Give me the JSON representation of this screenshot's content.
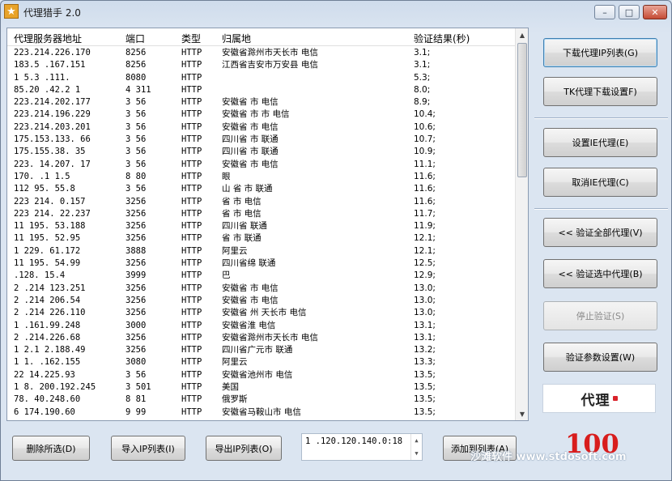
{
  "window": {
    "title": "代理猎手 2.0",
    "controls": {
      "minimize": "–",
      "maximize": "□",
      "close": "✕"
    }
  },
  "list": {
    "headers": {
      "address": "代理服务器地址",
      "port": "端口",
      "type": "类型",
      "location": "归属地",
      "result": "验证结果(秒)"
    },
    "rows": [
      {
        "address": "223.214.226.170",
        "port": "8256",
        "type": "HTTP",
        "location": "安徽省滁州市天长市 电信",
        "result": "3.1;"
      },
      {
        "address": "183.5 .167.151",
        "port": "8256",
        "type": "HTTP",
        "location": "江西省吉安市万安县 电信",
        "result": "3.1;"
      },
      {
        "address": "1 5.3 .111.",
        "port": "8080",
        "type": "HTTP",
        "location": "",
        "result": "5.3;"
      },
      {
        "address": "85.20 .42.2 1",
        "port": "4 311",
        "type": "HTTP",
        "location": "",
        "result": "8.0;"
      },
      {
        "address": "223.214.202.177",
        "port": "3 56",
        "type": "HTTP",
        "location": "安徽省 市 电信",
        "result": "8.9;"
      },
      {
        "address": "223.214.196.229",
        "port": "3 56",
        "type": "HTTP",
        "location": "安徽省 市 市 电信",
        "result": "10.4;"
      },
      {
        "address": "223.214.203.201",
        "port": "3 56",
        "type": "HTTP",
        "location": "安徽省 市 电信",
        "result": "10.6;"
      },
      {
        "address": "175.153.133. 66",
        "port": "3 56",
        "type": "HTTP",
        "location": "四川省 市 联通",
        "result": "10.7;"
      },
      {
        "address": "175.155.38. 35",
        "port": "3 56",
        "type": "HTTP",
        "location": "四川省 市 联通",
        "result": "10.9;"
      },
      {
        "address": "223. 14.207. 17",
        "port": "3 56",
        "type": "HTTP",
        "location": "安徽省 市 电信",
        "result": "11.1;"
      },
      {
        "address": "170.  .1 1.5",
        "port": "8 80",
        "type": "HTTP",
        "location": "  眼 ",
        "result": "11.6;"
      },
      {
        "address": "112  95. 55.8",
        "port": "3 56",
        "type": "HTTP",
        "location": "  山 省  市 联通",
        "result": "11.6;"
      },
      {
        "address": "223 214. 0.157",
        "port": "3256",
        "type": "HTTP",
        "location": "  省  市 电信",
        "result": "11.6;"
      },
      {
        "address": "223 214. 22.237",
        "port": "3256",
        "type": "HTTP",
        "location": "  省  市 电信",
        "result": "11.7;"
      },
      {
        "address": "11  195. 53.188",
        "port": "3256",
        "type": "HTTP",
        "location": "四川省  联通",
        "result": "11.9;"
      },
      {
        "address": "11  195. 52.95",
        "port": "3256",
        "type": "HTTP",
        "location": "  省  市 联通",
        "result": "12.1;"
      },
      {
        "address": "1  229. 61.172",
        "port": "3888",
        "type": "HTTP",
        "location": "  阿里云",
        "result": "12.1;"
      },
      {
        "address": "11  195. 54.99",
        "port": "3256",
        "type": "HTTP",
        "location": "四川省绵  联通",
        "result": "12.5;"
      },
      {
        "address": "  .128. 15.4",
        "port": "3999",
        "type": "HTTP",
        "location": "巴 ",
        "result": "12.9;"
      },
      {
        "address": "2 .214 123.251",
        "port": "3256",
        "type": "HTTP",
        "location": "安徽省  市 电信",
        "result": "13.0;"
      },
      {
        "address": "2 .214 206.54",
        "port": "3256",
        "type": "HTTP",
        "location": "安徽省  市 电信",
        "result": "13.0;"
      },
      {
        "address": "2 .214 226.110",
        "port": "3256",
        "type": "HTTP",
        "location": "安徽省 州 天长市 电信",
        "result": "13.0;"
      },
      {
        "address": "1 .161.99.248",
        "port": "3000",
        "type": "HTTP",
        "location": "安徽省淮  电信",
        "result": "13.1;"
      },
      {
        "address": "2 .214.226.68",
        "port": "3256",
        "type": "HTTP",
        "location": "安徽省滁州市天长市 电信",
        "result": "13.1;"
      },
      {
        "address": "1 2.1 2.188.49",
        "port": "3256",
        "type": "HTTP",
        "location": "四川省广元市 联通",
        "result": "13.2;"
      },
      {
        "address": "1 1.  .162.155",
        "port": "3080",
        "type": "HTTP",
        "location": "  阿里云",
        "result": "13.3;"
      },
      {
        "address": "22  14.225.93",
        "port": "3 56",
        "type": "HTTP",
        "location": "安徽省池州市 电信",
        "result": "13.5;"
      },
      {
        "address": "1 8. 200.192.245",
        "port": "3 501",
        "type": "HTTP",
        "location": "美国",
        "result": "13.5;"
      },
      {
        "address": "78. 40.248.60",
        "port": "8 81",
        "type": "HTTP",
        "location": "俄罗斯",
        "result": "13.5;"
      },
      {
        "address": "6  174.190.60",
        "port": "9 99",
        "type": "HTTP",
        "location": "安徽省马鞍山市 电信",
        "result": "13.5;"
      }
    ]
  },
  "side": {
    "download_list": "下载代理IP列表(G)",
    "download_settings": "TK代理下载设置F)",
    "set_ie_proxy": "设置IE代理(E)",
    "cancel_ie_proxy": "取消IE代理(C)",
    "verify_all": "<< 验证全部代理(V)",
    "verify_selected": "<< 验证选中代理(B)",
    "stop_verify": "停止验证(S)",
    "verify_params": "验证参数设置(W)",
    "logo_text": "代理"
  },
  "bottom": {
    "delete_selected": "删除所选(D)",
    "import_list": "导入IP列表(I)",
    "export_list": "导出IP列表(O)",
    "ip_input_value": "1  .120.120.140.0:18",
    "add_to_list": "添加到列表(A)",
    "count": "100",
    "watermark": "沙滩软件 www.stdosoft.com"
  }
}
